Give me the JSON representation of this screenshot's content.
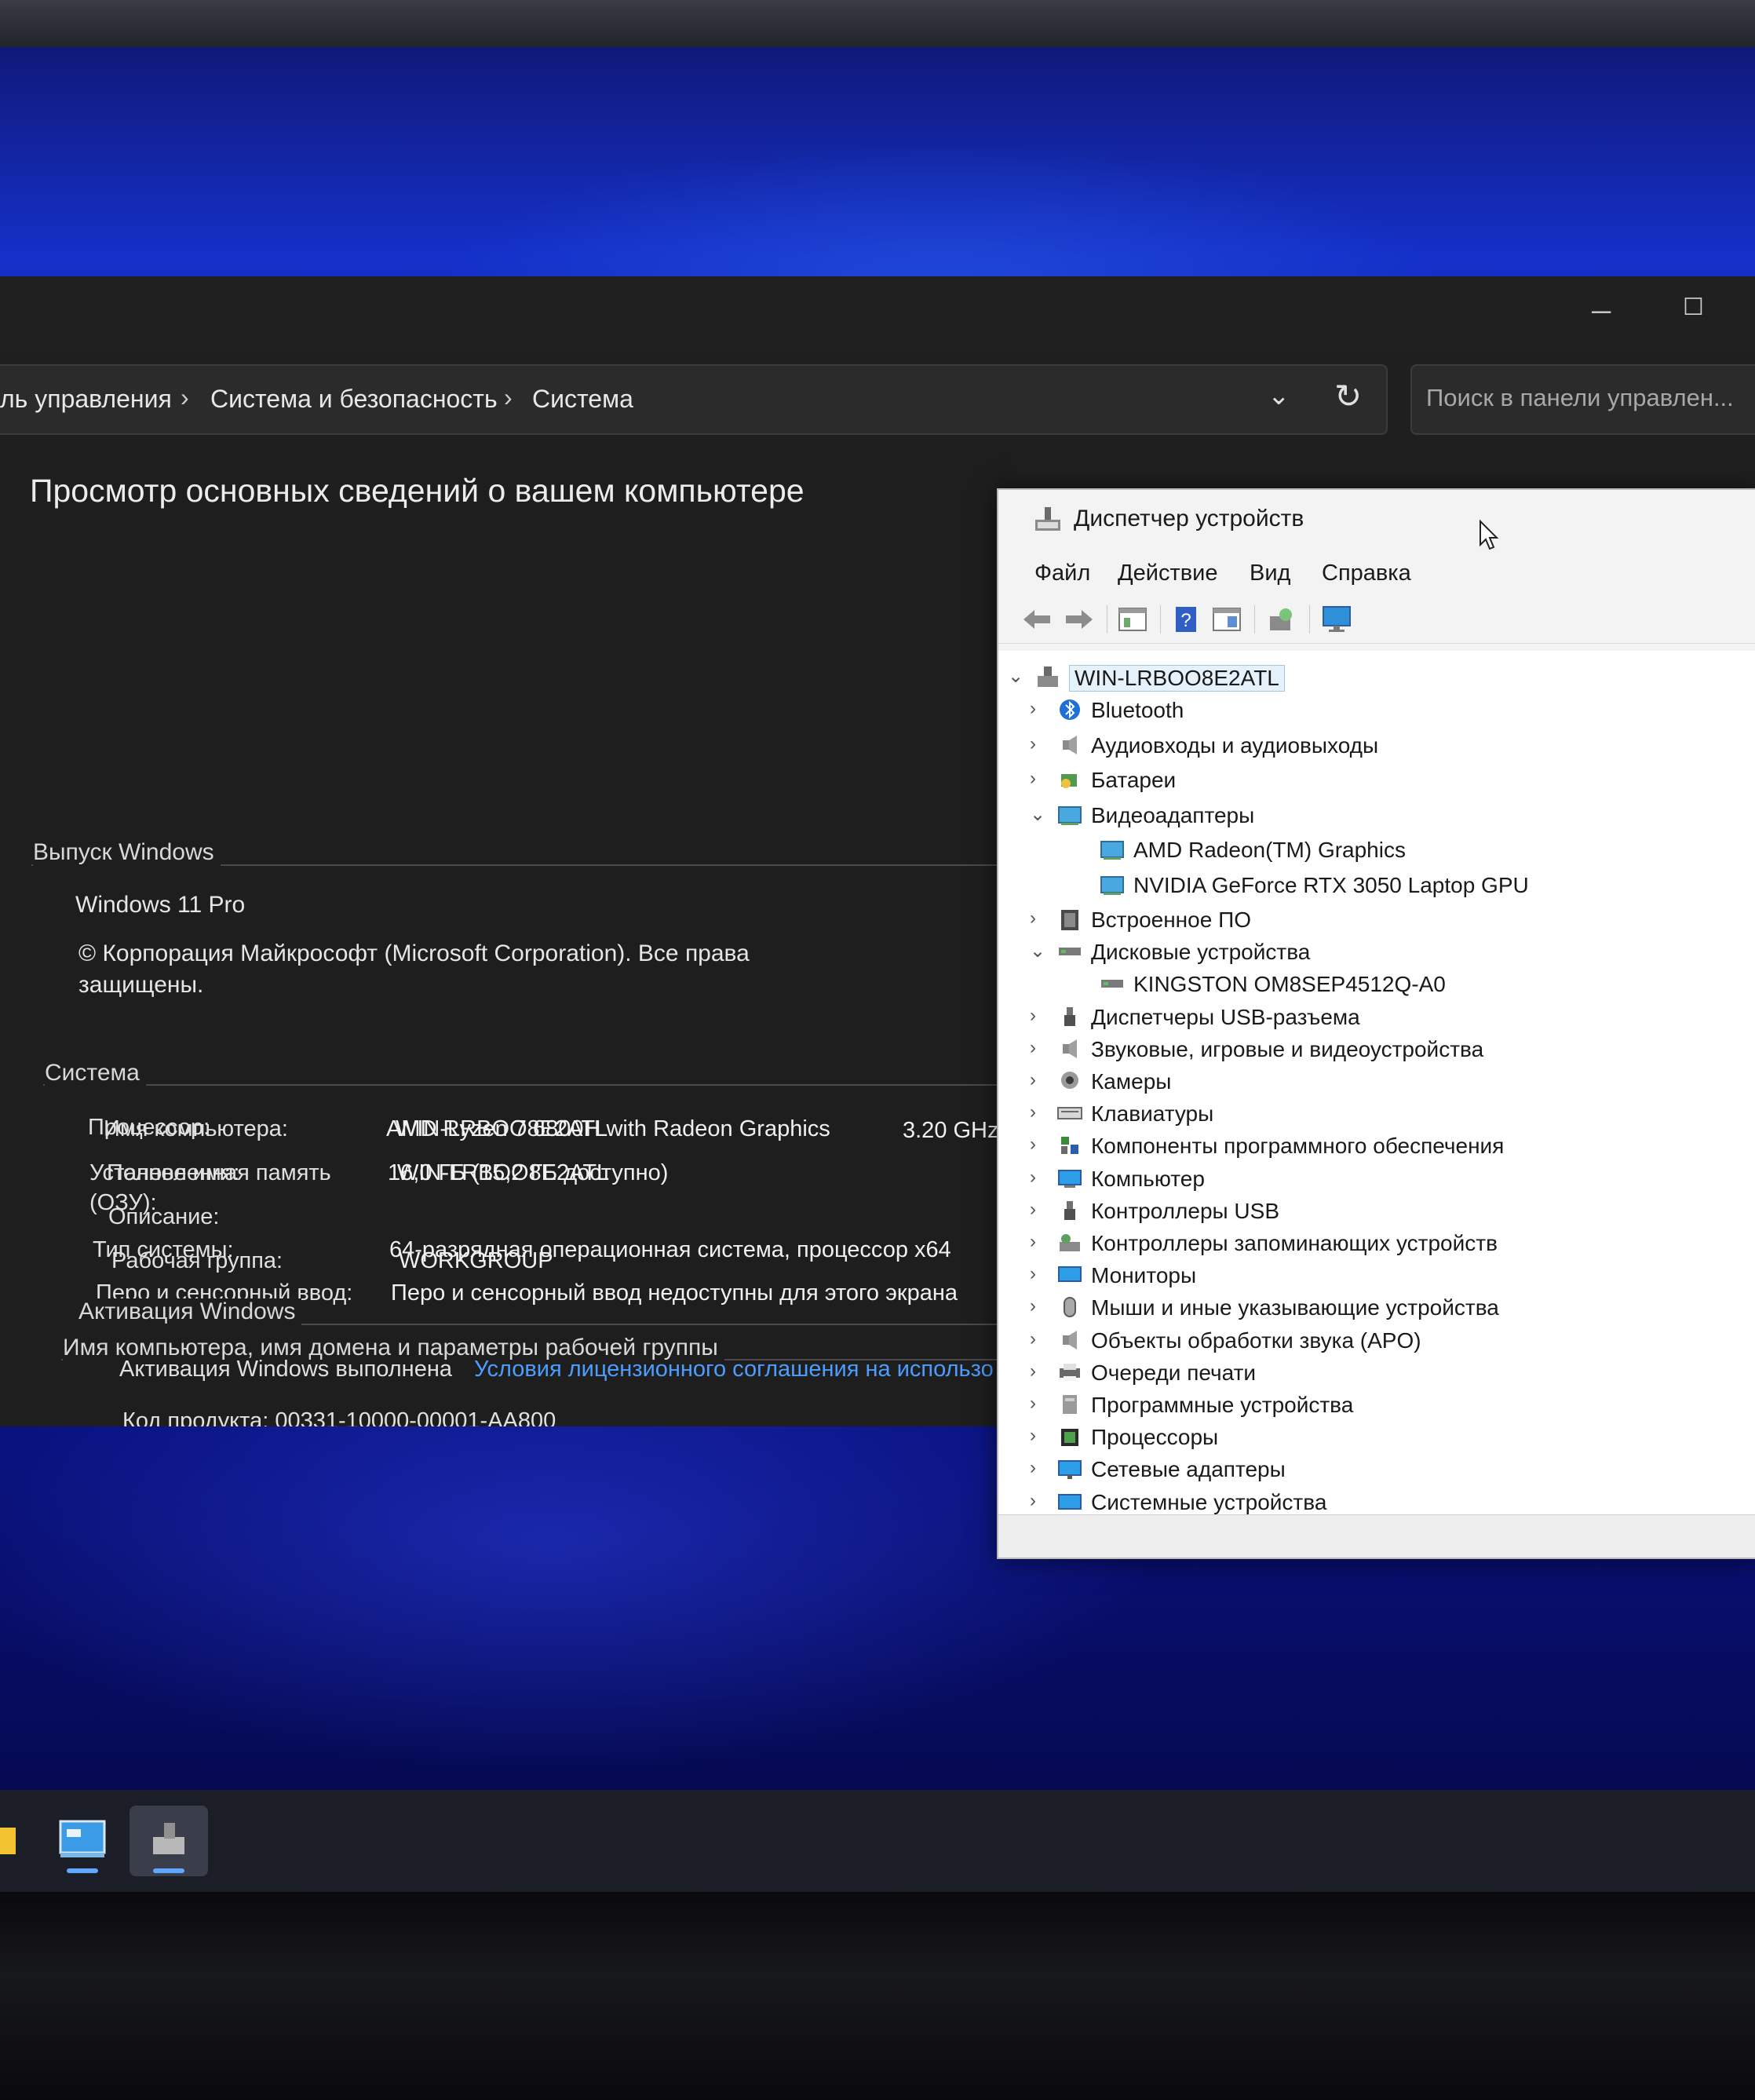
{
  "control_panel": {
    "breadcrumb": [
      "ль управления",
      "Система и безопасность",
      "Система"
    ],
    "search_placeholder": "Поиск в панели управлен...",
    "heading": "Просмотр основных сведений о вашем компьютере",
    "windows_edition": {
      "title": "Выпуск Windows",
      "edition": "Windows 11 Pro",
      "copyright_line1": "© Корпорация Майкрософт (Microsoft Corporation). Все права",
      "copyright_line2": "защищены."
    },
    "system": {
      "title": "Система",
      "processor_label": "Процессор:",
      "processor_value": "AMD Ryzen 7 6800H with Radeon Graphics",
      "processor_speed": "3.20 GHz",
      "memory_label_line1": "Установленная память",
      "memory_label_line2": "(ОЗУ):",
      "memory_value": "16,0 ГБ (15,2 ГБ доступно)",
      "type_label": "Тип системы:",
      "type_value": "64-разрядная операционная система, процессор x64",
      "pen_label": "Перо и сенсорный ввод:",
      "pen_value": "Перо и сенсорный ввод недоступны для этого экрана"
    },
    "computer_name": {
      "title": "Имя компьютера, имя домена и параметры рабочей группы",
      "name_label": "Имя компьютера:",
      "name_value": "WIN-LRBOO8E2ATL",
      "full_label": "Полное имя:",
      "full_value": "WIN-LRBOO8E2ATL",
      "desc_label": "Описание:",
      "group_label": "Рабочая группа:",
      "group_value": "WORKGROUP"
    },
    "activation": {
      "title": "Активация Windows",
      "status": "Активация Windows выполнена",
      "license_link": "Условия лицензионного соглашения на использо",
      "product_key_partial": "Код продукта: 00331-10000-00001-AA800"
    }
  },
  "device_manager": {
    "title": "Диспетчер устройств",
    "menu": [
      "Файл",
      "Действие",
      "Вид",
      "Справка"
    ],
    "root": "WIN-LRBOO8E2ATL",
    "nodes": [
      {
        "label": "Bluetooth",
        "icon": "bluetooth-icon",
        "expanded": false
      },
      {
        "label": "Аудиовходы и аудиовыходы",
        "icon": "speaker-icon",
        "expanded": false
      },
      {
        "label": "Батареи",
        "icon": "battery-icon",
        "expanded": false
      },
      {
        "label": "Видеоадаптеры",
        "icon": "display-adapter-icon",
        "expanded": true
      },
      {
        "label": "AMD Radeon(TM) Graphics",
        "icon": "display-adapter-icon",
        "child": true
      },
      {
        "label": "NVIDIA GeForce RTX 3050 Laptop GPU",
        "icon": "display-adapter-icon",
        "child": true
      },
      {
        "label": "Встроенное ПО",
        "icon": "firmware-icon",
        "expanded": false
      },
      {
        "label": "Дисковые устройства",
        "icon": "disk-icon",
        "expanded": true
      },
      {
        "label": "KINGSTON OM8SEP4512Q-A0",
        "icon": "disk-icon",
        "child": true
      },
      {
        "label": "Диспетчеры USB-разъема",
        "icon": "usb-icon",
        "expanded": false
      },
      {
        "label": "Звуковые, игровые и видеоустройства",
        "icon": "speaker-icon",
        "expanded": false
      },
      {
        "label": "Камеры",
        "icon": "camera-icon",
        "expanded": false
      },
      {
        "label": "Клавиатуры",
        "icon": "keyboard-icon",
        "expanded": false
      },
      {
        "label": "Компоненты программного обеспечения",
        "icon": "software-component-icon",
        "expanded": false
      },
      {
        "label": "Компьютер",
        "icon": "computer-icon",
        "expanded": false
      },
      {
        "label": "Контроллеры USB",
        "icon": "usb-icon",
        "expanded": false
      },
      {
        "label": "Контроллеры запоминающих устройств",
        "icon": "storage-controller-icon",
        "expanded": false
      },
      {
        "label": "Мониторы",
        "icon": "monitor-icon",
        "expanded": false
      },
      {
        "label": "Мыши и иные указывающие устройства",
        "icon": "mouse-icon",
        "expanded": false
      },
      {
        "label": "Объекты обработки звука (APO)",
        "icon": "speaker-icon",
        "expanded": false
      },
      {
        "label": "Очереди печати",
        "icon": "printer-icon",
        "expanded": false
      },
      {
        "label": "Программные устройства",
        "icon": "software-device-icon",
        "expanded": false
      },
      {
        "label": "Процессоры",
        "icon": "processor-icon",
        "expanded": false
      },
      {
        "label": "Сетевые адаптеры",
        "icon": "network-adapter-icon",
        "expanded": false
      },
      {
        "label": "Системные устройства",
        "icon": "system-device-icon",
        "expanded": false
      }
    ]
  }
}
